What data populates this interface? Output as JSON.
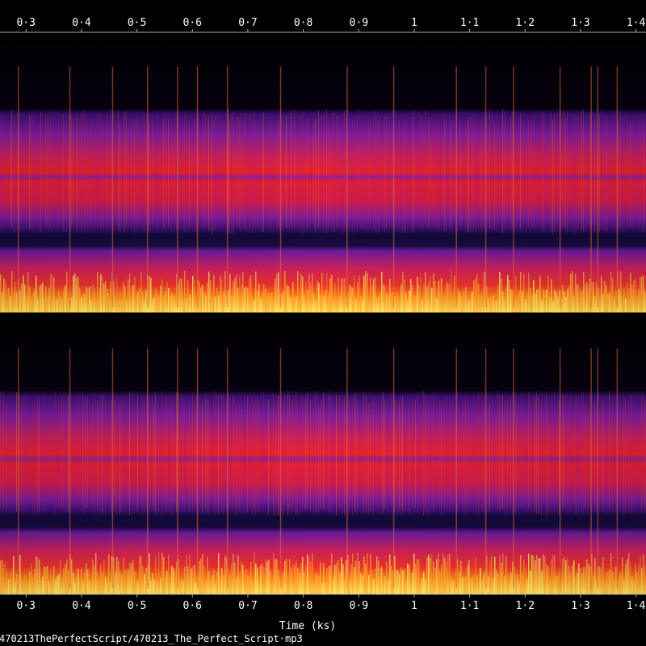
{
  "chart_data": {
    "type": "heatmap",
    "subtype": "spectrogram",
    "channels": 2,
    "x_tick_labels": [
      "0·3",
      "0·4",
      "0·5",
      "0·6",
      "0·7",
      "0·8",
      "0·9",
      "1",
      "1·1",
      "1·2",
      "1·3",
      "1·4"
    ],
    "x_tick_values": [
      0.3,
      0.4,
      0.5,
      0.6,
      0.7,
      0.8,
      0.9,
      1.0,
      1.1,
      1.2,
      1.3,
      1.4
    ],
    "xlim": [
      0.253,
      1.418
    ],
    "xlabel": "Time (ks)",
    "file_label": "470213ThePerfectScript/470213_The_Perfect_Script·mp3",
    "ticks_shown": [
      "top",
      "bottom"
    ],
    "colormap": "black-blue-purple-red-orange-yellow",
    "colors": {
      "background": "#000000",
      "axis_line": "#aaaaaa",
      "tick_text": "#ffffff",
      "low": "#000000",
      "navy": "#1a0840",
      "purple": "#5a1a9a",
      "magenta": "#b0207a",
      "red": "#e8202c",
      "orange": "#ff7a10",
      "yellow": "#ffe040",
      "white_hot": "#fff6b0"
    },
    "channel_bands": [
      {
        "name": "channel-1",
        "bands": [
          {
            "level": "silent",
            "color": "low"
          },
          {
            "level": "purple",
            "color": "purple"
          },
          {
            "level": "red",
            "color": "red"
          },
          {
            "level": "purple-line",
            "color": "magenta"
          },
          {
            "level": "red",
            "color": "red"
          },
          {
            "level": "purple",
            "color": "purple"
          },
          {
            "level": "navy-gap",
            "color": "navy"
          },
          {
            "level": "red",
            "color": "red"
          },
          {
            "level": "orange",
            "color": "orange"
          },
          {
            "level": "yellow",
            "color": "yellow"
          }
        ]
      },
      {
        "name": "channel-2",
        "bands": [
          {
            "level": "silent",
            "color": "low"
          },
          {
            "level": "purple",
            "color": "purple"
          },
          {
            "level": "red",
            "color": "red"
          },
          {
            "level": "purple-line",
            "color": "magenta"
          },
          {
            "level": "red",
            "color": "red"
          },
          {
            "level": "purple",
            "color": "purple"
          },
          {
            "level": "navy-gap",
            "color": "navy"
          },
          {
            "level": "red",
            "color": "red"
          },
          {
            "level": "orange",
            "color": "orange"
          },
          {
            "level": "yellow",
            "color": "yellow"
          }
        ]
      }
    ],
    "transient_columns_ks": [
      0.285,
      0.378,
      0.455,
      0.518,
      0.572,
      0.608,
      0.662,
      0.758,
      0.878,
      0.962,
      1.075,
      1.128,
      1.178,
      1.262,
      1.318,
      1.33,
      1.365
    ]
  }
}
